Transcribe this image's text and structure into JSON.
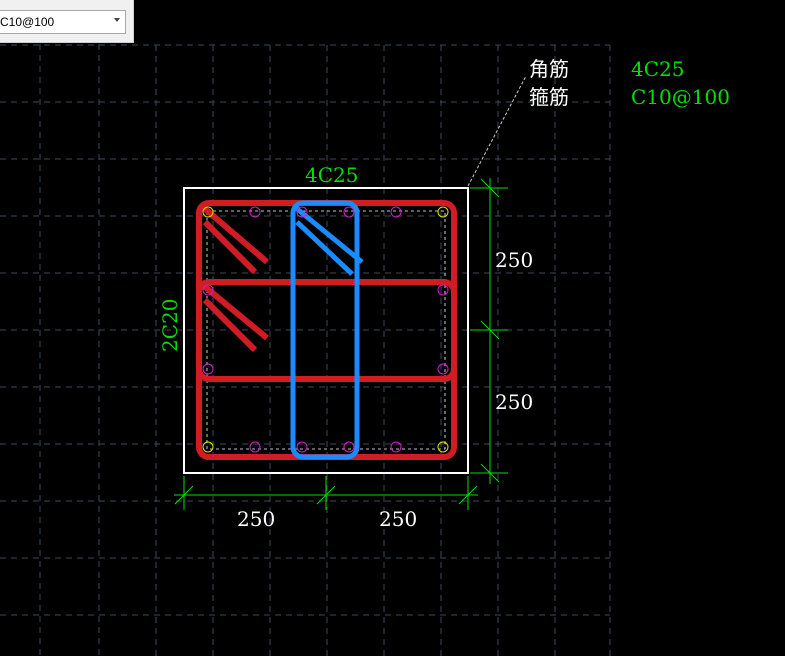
{
  "toolbar": {
    "combo_value": "C10@100"
  },
  "section": {
    "top_bar_label": "4C25",
    "side_bar_label": "2C20",
    "dims": {
      "right_top": "250",
      "right_bottom": "250",
      "bottom_left": "250",
      "bottom_right": "250"
    }
  },
  "legend": {
    "corner_bar_title": "角筋",
    "stirrup_title": "箍筋",
    "corner_bar_value": "4C25",
    "stirrup_value": "C10@100"
  },
  "colors": {
    "background": "#000000",
    "grid": "#3c4a5a",
    "concrete_outline": "#ffffff",
    "stirrup_outer": "#d01c24",
    "stirrup_inner_blue": "#1a8cff",
    "dimension": "#00e000",
    "side_bar_marker": "#d020d0",
    "corner_bar_marker": "#e0e000",
    "label_green": "#00e000",
    "label_white": "#ffffff"
  }
}
